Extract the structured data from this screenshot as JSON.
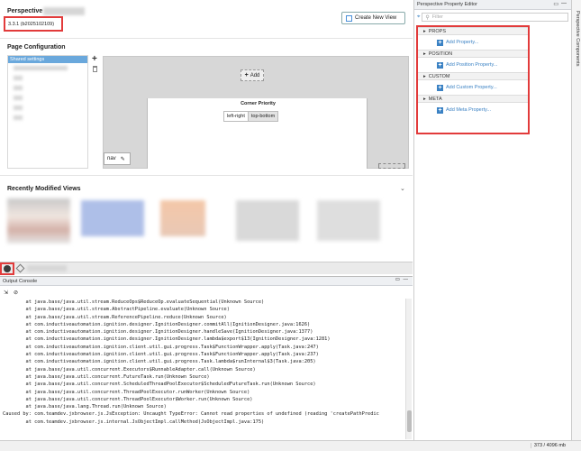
{
  "perspective": {
    "title": "Perspective",
    "version": "3.3.1 (b2025102109)",
    "create_button": "Create New View"
  },
  "page_config": {
    "title": "Page Configuration",
    "shared_settings": "Shared settings",
    "add_label": "Add",
    "corner_priority": {
      "title": "Corner Priority",
      "left_right": "left-right",
      "top_bottom": "top-bottom"
    },
    "nav_label": "nav"
  },
  "recent": {
    "title": "Recently Modified Views"
  },
  "property_editor": {
    "title": "Perspective Property Editor",
    "filter_placeholder": "Filter",
    "categories": [
      {
        "name": "PROPS",
        "add": "Add Property..."
      },
      {
        "name": "POSITION",
        "add": "Add Position Property..."
      },
      {
        "name": "CUSTOM",
        "add": "Add Custom Property..."
      },
      {
        "name": "META",
        "add": "Add Meta Property..."
      }
    ]
  },
  "side_tab": {
    "label": "Perspective Components"
  },
  "console": {
    "title": "Output Console",
    "lines": [
      "        at java.base/java.util.stream.ReduceOps$ReduceOp.evaluateSequential(Unknown Source)",
      "        at java.base/java.util.stream.AbstractPipeline.evaluate(Unknown Source)",
      "        at java.base/java.util.stream.ReferencePipeline.reduce(Unknown Source)",
      "        at com.inductiveautomation.ignition.designer.IgnitionDesigner.commitAll(IgnitionDesigner.java:1626)",
      "        at com.inductiveautomation.ignition.designer.IgnitionDesigner.handleSave(IgnitionDesigner.java:1377)",
      "        at com.inductiveautomation.ignition.designer.IgnitionDesigner.lambda$export$13(IgnitionDesigner.java:1281)",
      "        at com.inductiveautomation.ignition.client.util.gui.progress.Task$FunctionWrapper.apply(Task.java:247)",
      "        at com.inductiveautomation.ignition.client.util.gui.progress.Task$FunctionWrapper.apply(Task.java:237)",
      "        at com.inductiveautomation.ignition.client.util.gui.progress.Task.lambda$runInternal$3(Task.java:205)",
      "        at java.base/java.util.concurrent.Executors$RunnableAdapter.call(Unknown Source)",
      "        at java.base/java.util.concurrent.FutureTask.run(Unknown Source)",
      "        at java.base/java.util.concurrent.ScheduledThreadPoolExecutor$ScheduledFutureTask.run(Unknown Source)",
      "        at java.base/java.util.concurrent.ThreadPoolExecutor.runWorker(Unknown Source)",
      "        at java.base/java.util.concurrent.ThreadPoolExecutor$Worker.run(Unknown Source)",
      "        at java.base/java.lang.Thread.run(Unknown Source)",
      "Caused by: com.teamdev.jxbrowser.js.JsException: Uncaught TypeError: Cannot read properties of undefined (reading 'createPathPredic",
      "        at com.teamdev.jxbrowser.js.internal.JsObjectImpl.callMethod(JsObjectImpl.java:175)"
    ]
  },
  "status": {
    "memory": "373 / 4096 mb"
  },
  "colors": {
    "accent": "#3b82c4",
    "highlight_red": "#e23b3b",
    "selection_blue": "#6aa8dc"
  }
}
